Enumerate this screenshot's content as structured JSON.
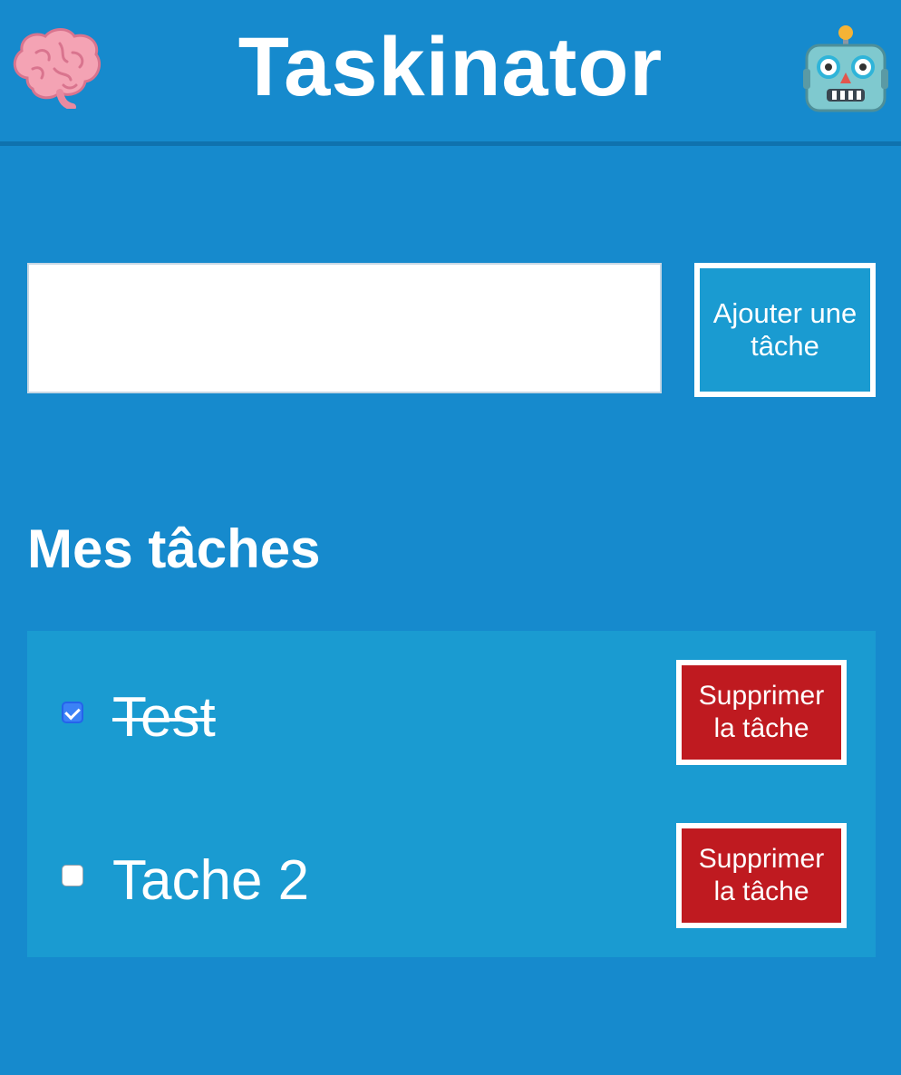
{
  "header": {
    "title": "Taskinator",
    "left_icon": "brain-icon",
    "right_icon": "robot-icon"
  },
  "form": {
    "input_value": "",
    "input_placeholder": "",
    "add_button_label": "Ajouter une tâche"
  },
  "section": {
    "title": "Mes tâches"
  },
  "tasks": [
    {
      "text": "Test",
      "completed": true,
      "delete_label": "Supprimer la tâche"
    },
    {
      "text": "Tache 2",
      "completed": false,
      "delete_label": "Supprimer la tâche"
    }
  ],
  "colors": {
    "background": "#168acd",
    "list_background": "#1a9bd1",
    "delete_button": "#bf1a20",
    "checkbox_checked": "#3b82f6"
  }
}
